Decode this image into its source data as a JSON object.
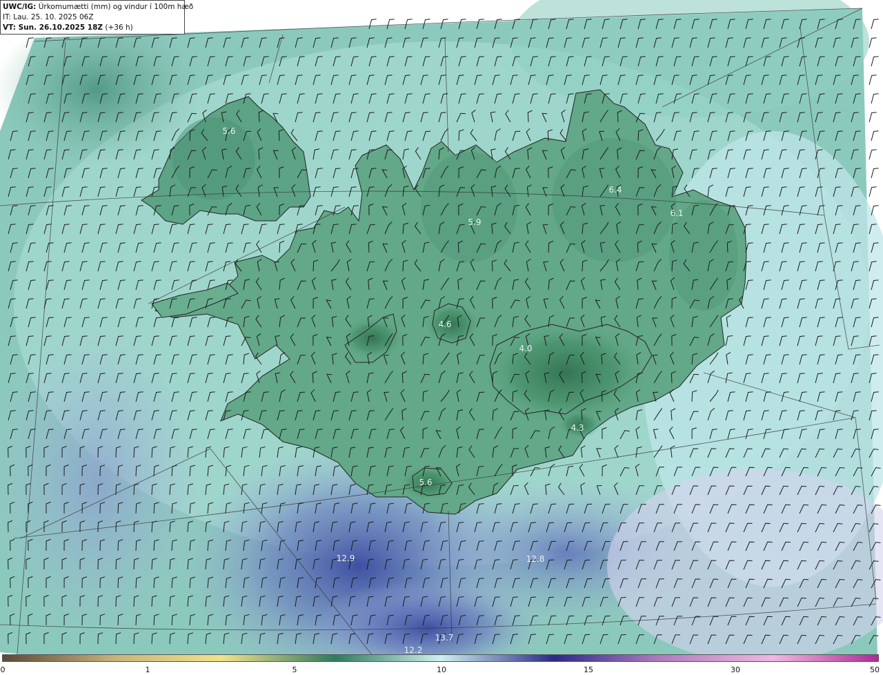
{
  "header": {
    "model": "UWC/IG:",
    "title_rest": "Úrkomumætti (mm) og vindur í 100m hæð",
    "issue_time": "IT: Lau. 25. 10. 2025 06Z",
    "valid_label": "VT: Sun. 26.10.2025 18Z",
    "valid_rest": "(+36 h)"
  },
  "map": {
    "region": "Iceland",
    "field": "Precipitable water (mm) and wind at 100 m"
  },
  "value_labels": [
    {
      "text": "5.6",
      "id": "vl-1"
    },
    {
      "text": "6.4",
      "id": "vl-2"
    },
    {
      "text": "6.1",
      "id": "vl-3"
    },
    {
      "text": "5.9",
      "id": "vl-4"
    },
    {
      "text": "4.6",
      "id": "vl-5"
    },
    {
      "text": "4.0",
      "id": "vl-6"
    },
    {
      "text": "4.3",
      "id": "vl-7"
    },
    {
      "text": "5.6",
      "id": "vl-8"
    },
    {
      "text": "12.9",
      "id": "vl-9"
    },
    {
      "text": "12.8",
      "id": "vl-10"
    },
    {
      "text": "13.7",
      "id": "vl-11"
    },
    {
      "text": "12.2",
      "id": "vl-12"
    }
  ],
  "colorbar": {
    "ticks": [
      "0",
      "1",
      "5",
      "10",
      "15",
      "30",
      "50"
    ],
    "colors": [
      "#5a4a3a",
      "#c9b47a",
      "#f2e28a",
      "#2f7a5e",
      "#cff0ee",
      "#2a2a8a",
      "#b07ac0",
      "#f0b8e0",
      "#b02a9a"
    ]
  }
}
